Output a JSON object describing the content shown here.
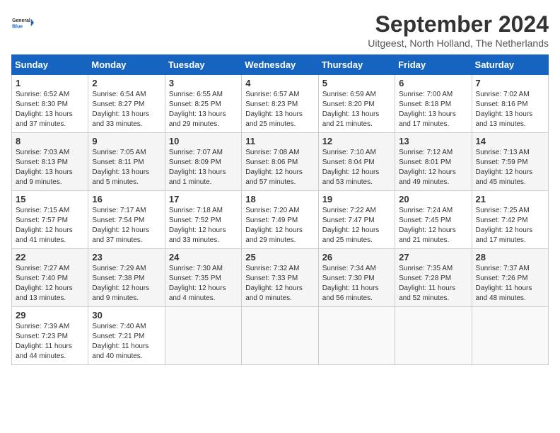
{
  "header": {
    "logo_line1": "General",
    "logo_line2": "Blue",
    "month_title": "September 2024",
    "subtitle": "Uitgeest, North Holland, The Netherlands"
  },
  "weekdays": [
    "Sunday",
    "Monday",
    "Tuesday",
    "Wednesday",
    "Thursday",
    "Friday",
    "Saturday"
  ],
  "weeks": [
    [
      {
        "day": "1",
        "info": "Sunrise: 6:52 AM\nSunset: 8:30 PM\nDaylight: 13 hours\nand 37 minutes."
      },
      {
        "day": "2",
        "info": "Sunrise: 6:54 AM\nSunset: 8:27 PM\nDaylight: 13 hours\nand 33 minutes."
      },
      {
        "day": "3",
        "info": "Sunrise: 6:55 AM\nSunset: 8:25 PM\nDaylight: 13 hours\nand 29 minutes."
      },
      {
        "day": "4",
        "info": "Sunrise: 6:57 AM\nSunset: 8:23 PM\nDaylight: 13 hours\nand 25 minutes."
      },
      {
        "day": "5",
        "info": "Sunrise: 6:59 AM\nSunset: 8:20 PM\nDaylight: 13 hours\nand 21 minutes."
      },
      {
        "day": "6",
        "info": "Sunrise: 7:00 AM\nSunset: 8:18 PM\nDaylight: 13 hours\nand 17 minutes."
      },
      {
        "day": "7",
        "info": "Sunrise: 7:02 AM\nSunset: 8:16 PM\nDaylight: 13 hours\nand 13 minutes."
      }
    ],
    [
      {
        "day": "8",
        "info": "Sunrise: 7:03 AM\nSunset: 8:13 PM\nDaylight: 13 hours\nand 9 minutes."
      },
      {
        "day": "9",
        "info": "Sunrise: 7:05 AM\nSunset: 8:11 PM\nDaylight: 13 hours\nand 5 minutes."
      },
      {
        "day": "10",
        "info": "Sunrise: 7:07 AM\nSunset: 8:09 PM\nDaylight: 13 hours\nand 1 minute."
      },
      {
        "day": "11",
        "info": "Sunrise: 7:08 AM\nSunset: 8:06 PM\nDaylight: 12 hours\nand 57 minutes."
      },
      {
        "day": "12",
        "info": "Sunrise: 7:10 AM\nSunset: 8:04 PM\nDaylight: 12 hours\nand 53 minutes."
      },
      {
        "day": "13",
        "info": "Sunrise: 7:12 AM\nSunset: 8:01 PM\nDaylight: 12 hours\nand 49 minutes."
      },
      {
        "day": "14",
        "info": "Sunrise: 7:13 AM\nSunset: 7:59 PM\nDaylight: 12 hours\nand 45 minutes."
      }
    ],
    [
      {
        "day": "15",
        "info": "Sunrise: 7:15 AM\nSunset: 7:57 PM\nDaylight: 12 hours\nand 41 minutes."
      },
      {
        "day": "16",
        "info": "Sunrise: 7:17 AM\nSunset: 7:54 PM\nDaylight: 12 hours\nand 37 minutes."
      },
      {
        "day": "17",
        "info": "Sunrise: 7:18 AM\nSunset: 7:52 PM\nDaylight: 12 hours\nand 33 minutes."
      },
      {
        "day": "18",
        "info": "Sunrise: 7:20 AM\nSunset: 7:49 PM\nDaylight: 12 hours\nand 29 minutes."
      },
      {
        "day": "19",
        "info": "Sunrise: 7:22 AM\nSunset: 7:47 PM\nDaylight: 12 hours\nand 25 minutes."
      },
      {
        "day": "20",
        "info": "Sunrise: 7:24 AM\nSunset: 7:45 PM\nDaylight: 12 hours\nand 21 minutes."
      },
      {
        "day": "21",
        "info": "Sunrise: 7:25 AM\nSunset: 7:42 PM\nDaylight: 12 hours\nand 17 minutes."
      }
    ],
    [
      {
        "day": "22",
        "info": "Sunrise: 7:27 AM\nSunset: 7:40 PM\nDaylight: 12 hours\nand 13 minutes."
      },
      {
        "day": "23",
        "info": "Sunrise: 7:29 AM\nSunset: 7:38 PM\nDaylight: 12 hours\nand 9 minutes."
      },
      {
        "day": "24",
        "info": "Sunrise: 7:30 AM\nSunset: 7:35 PM\nDaylight: 12 hours\nand 4 minutes."
      },
      {
        "day": "25",
        "info": "Sunrise: 7:32 AM\nSunset: 7:33 PM\nDaylight: 12 hours\nand 0 minutes."
      },
      {
        "day": "26",
        "info": "Sunrise: 7:34 AM\nSunset: 7:30 PM\nDaylight: 11 hours\nand 56 minutes."
      },
      {
        "day": "27",
        "info": "Sunrise: 7:35 AM\nSunset: 7:28 PM\nDaylight: 11 hours\nand 52 minutes."
      },
      {
        "day": "28",
        "info": "Sunrise: 7:37 AM\nSunset: 7:26 PM\nDaylight: 11 hours\nand 48 minutes."
      }
    ],
    [
      {
        "day": "29",
        "info": "Sunrise: 7:39 AM\nSunset: 7:23 PM\nDaylight: 11 hours\nand 44 minutes."
      },
      {
        "day": "30",
        "info": "Sunrise: 7:40 AM\nSunset: 7:21 PM\nDaylight: 11 hours\nand 40 minutes."
      },
      {
        "day": "",
        "info": ""
      },
      {
        "day": "",
        "info": ""
      },
      {
        "day": "",
        "info": ""
      },
      {
        "day": "",
        "info": ""
      },
      {
        "day": "",
        "info": ""
      }
    ]
  ]
}
